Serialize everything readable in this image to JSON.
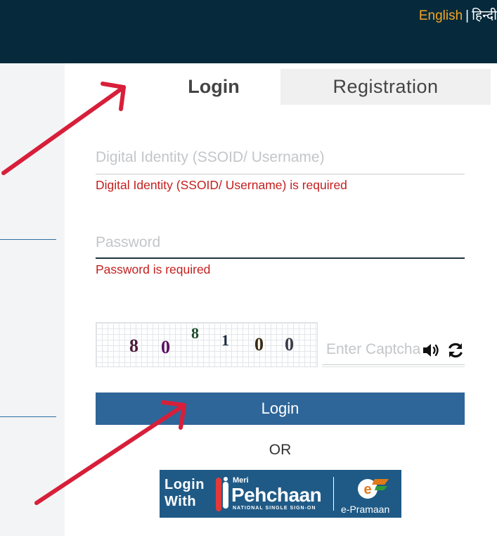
{
  "header": {
    "lang_english": "English",
    "lang_separator": "|",
    "lang_hindi": "हिन्दी"
  },
  "tabs": {
    "login": "Login",
    "registration": "Registration"
  },
  "form": {
    "username_placeholder": "Digital Identity (SSOID/ Username)",
    "username_error": "Digital Identity (SSOID/ Username) is required",
    "password_placeholder": "Password",
    "password_error": "Password is required",
    "captcha_digits": [
      "8",
      "0",
      "8",
      "1",
      "0",
      "0"
    ],
    "captcha_placeholder": "Enter Captcha",
    "login_button": "Login",
    "or_text": "OR"
  },
  "meri_pehchaan": {
    "login_with_line1": "Login",
    "login_with_line2": "With",
    "meri": "Meri",
    "pehchaan": "Pehchaan",
    "tagline": "NATIONAL SINGLE SIGN-ON",
    "epramaan": "e-Pramaan"
  },
  "icons": {
    "audio": "speaker-icon",
    "refresh": "refresh-icon"
  },
  "colors": {
    "header_bg": "#062a3c",
    "accent_lang": "#f5a623",
    "error": "#c41e1e",
    "button": "#2f6699",
    "annotation_arrow": "#d71f3a"
  }
}
